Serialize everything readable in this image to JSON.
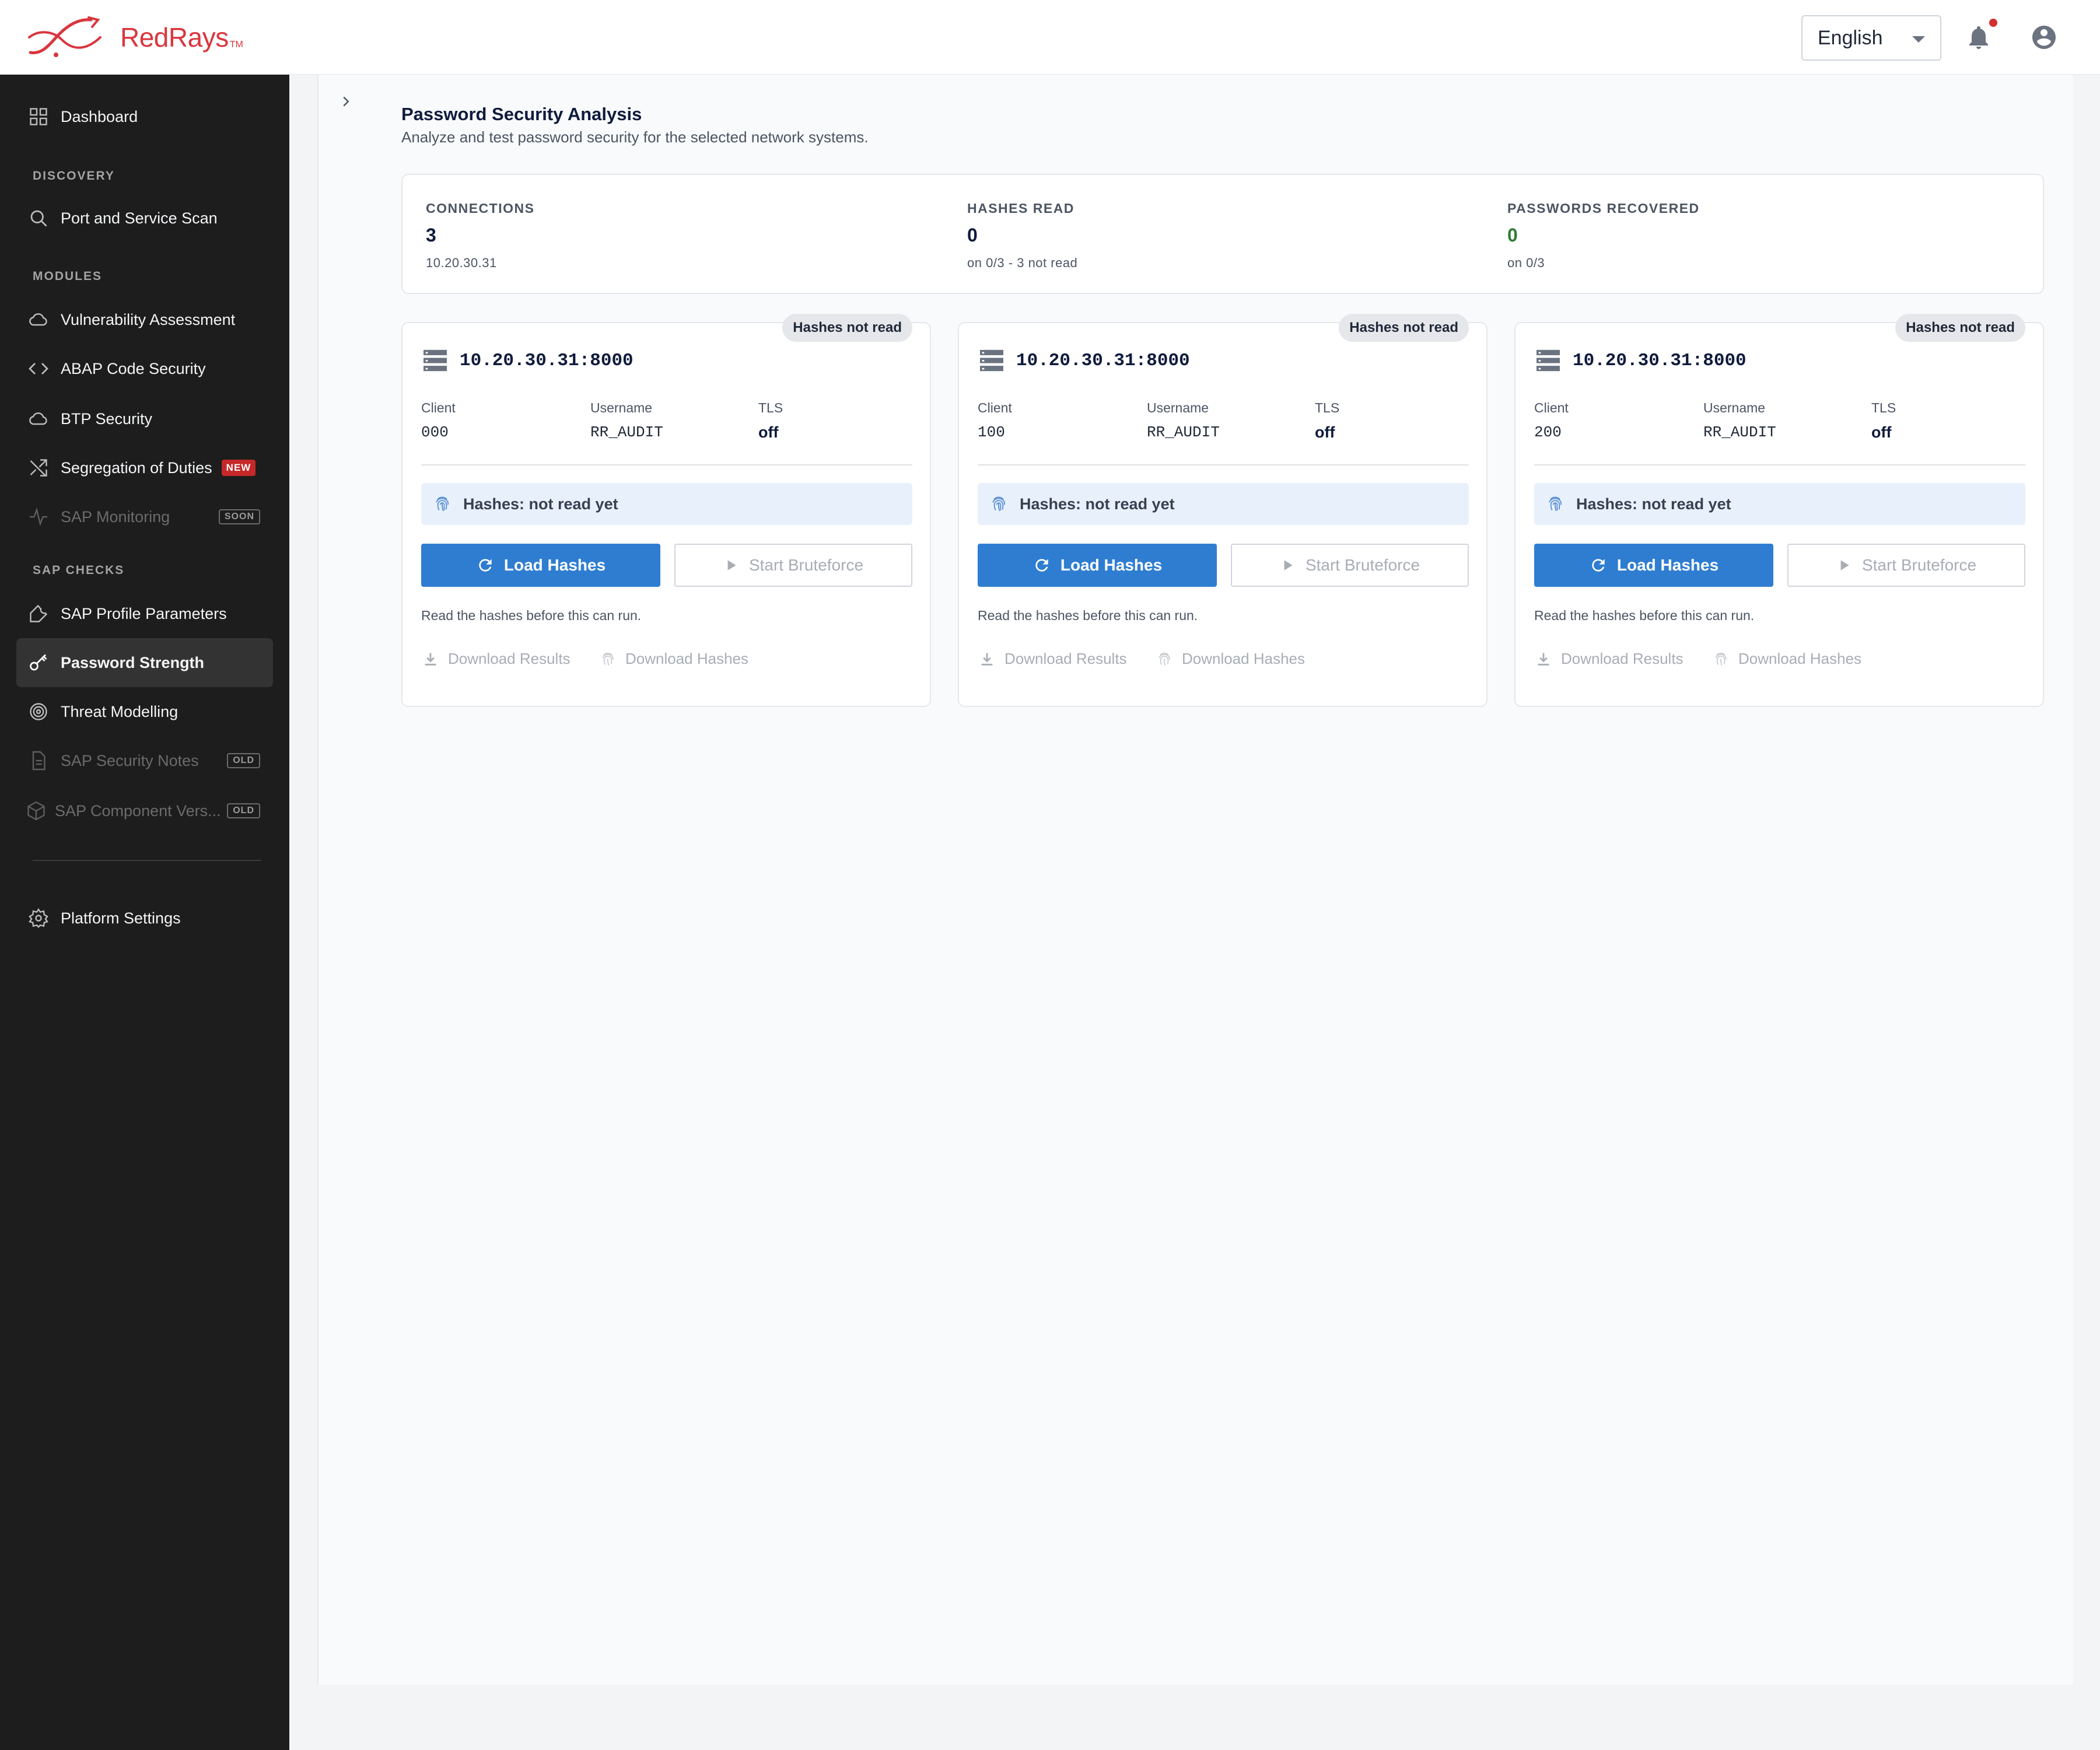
{
  "header": {
    "brand": "RedRays",
    "brand_tm": "TM",
    "language": "English"
  },
  "sidebar": {
    "dashboard": "Dashboard",
    "sections": {
      "discovery": "DISCOVERY",
      "modules": "MODULES",
      "sap_checks": "SAP CHECKS"
    },
    "items": {
      "port_scan": "Port and Service Scan",
      "vuln": "Vulnerability Assessment",
      "abap": "ABAP Code Security",
      "btp": "BTP Security",
      "sod": "Segregation of Duties",
      "sod_badge": "NEW",
      "monitoring": "SAP Monitoring",
      "monitoring_badge": "SOON",
      "profile": "SAP Profile Parameters",
      "password": "Password Strength",
      "threat": "Threat Modelling",
      "notes": "SAP Security Notes",
      "notes_badge": "OLD",
      "component": "SAP Component Vers...",
      "component_badge": "OLD",
      "settings": "Platform Settings"
    }
  },
  "page": {
    "title": "Password Security Analysis",
    "subtitle": "Analyze and test password security for the selected network systems."
  },
  "summary": {
    "connections_label": "CONNECTIONS",
    "connections_value": "3",
    "connections_sub": "10.20.30.31",
    "hashes_label": "HASHES READ",
    "hashes_value": "0",
    "hashes_sub": "on 0/3 - 3 not read",
    "recovered_label": "PASSWORDS RECOVERED",
    "recovered_value": "0",
    "recovered_sub": "on 0/3",
    "recovered_color": "#2e7d32"
  },
  "labels": {
    "client": "Client",
    "username": "Username",
    "tls": "TLS",
    "load_hashes": "Load Hashes",
    "start_bruteforce": "Start Bruteforce",
    "hint": "Read the hashes before this can run.",
    "download_results": "Download Results",
    "download_hashes": "Download Hashes"
  },
  "systems": [
    {
      "badge": "Hashes not read",
      "host": "10.20.30.31:8000",
      "client": "000",
      "username": "RR_AUDIT",
      "tls": "off",
      "hash_status": "Hashes: not read yet"
    },
    {
      "badge": "Hashes not read",
      "host": "10.20.30.31:8000",
      "client": "100",
      "username": "RR_AUDIT",
      "tls": "off",
      "hash_status": "Hashes: not read yet"
    },
    {
      "badge": "Hashes not read",
      "host": "10.20.30.31:8000",
      "client": "200",
      "username": "RR_AUDIT",
      "tls": "off",
      "hash_status": "Hashes: not read yet"
    }
  ],
  "colors": {
    "brand": "#d9363e",
    "primary_button": "#2f7dd1",
    "sidebar_bg": "#1d1d1d"
  }
}
